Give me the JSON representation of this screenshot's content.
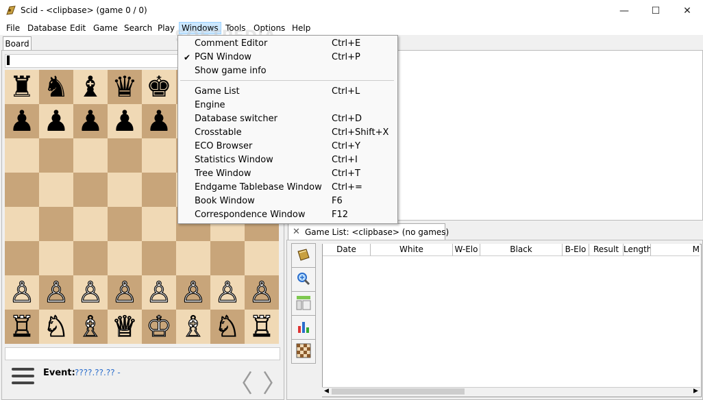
{
  "window": {
    "title": "Scid - <clipbase> (game 0 / 0)",
    "minimize_glyph": "—",
    "maximize_glyph": "☐",
    "close_glyph": "✕"
  },
  "menubar": {
    "items": [
      "File",
      "Database",
      "Edit",
      "Game",
      "Search",
      "Play",
      "Windows",
      "Tools",
      "Options",
      "Help"
    ],
    "active": "Windows"
  },
  "board_tab": {
    "label": "Board"
  },
  "board": {
    "rows": [
      [
        "♜",
        "♞",
        "♝",
        "♛",
        "♚",
        "",
        "",
        ""
      ],
      [
        "♟",
        "♟",
        "♟",
        "♟",
        "♟",
        "",
        "",
        ""
      ],
      [
        "",
        "",
        "",
        "",
        "",
        "",
        "",
        ""
      ],
      [
        "",
        "",
        "",
        "",
        "",
        "",
        "",
        ""
      ],
      [
        "",
        "",
        "",
        "",
        "",
        "",
        "",
        ""
      ],
      [
        "",
        "",
        "",
        "",
        "",
        "",
        "",
        ""
      ],
      [
        "♙",
        "♙",
        "♙",
        "♙",
        "♙",
        "♙",
        "♙",
        "♙"
      ],
      [
        "♖",
        "♘",
        "♗",
        "♕",
        "♔",
        "♗",
        "♘",
        "♖"
      ]
    ],
    "light_color": "#f0d9b5",
    "dark_color": "#c8a57a"
  },
  "event": {
    "label": "Event:",
    "value": "????.??.?? -"
  },
  "nav": {
    "prev": "〈",
    "next": "〉"
  },
  "game_list": {
    "tab_title": "Game List: <clipbase> (no games)",
    "close_glyph": "✕",
    "columns": [
      "Date",
      "White",
      "W-Elo",
      "Black",
      "B-Elo",
      "Result",
      "Length",
      "M"
    ]
  },
  "watermark": "SOFTPEDIA",
  "windows_menu": {
    "items": [
      {
        "label": "Comment Editor",
        "accel": "Ctrl+E",
        "checked": false
      },
      {
        "label": "PGN Window",
        "accel": "Ctrl+P",
        "checked": true
      },
      {
        "label": "Show game info",
        "accel": "",
        "checked": false
      },
      {
        "label": "Game List",
        "accel": "Ctrl+L",
        "checked": false
      },
      {
        "label": "Engine",
        "accel": "",
        "checked": false
      },
      {
        "label": "Database switcher",
        "accel": "Ctrl+D",
        "checked": false
      },
      {
        "label": "Crosstable",
        "accel": "Ctrl+Shift+X",
        "checked": false
      },
      {
        "label": "ECO Browser",
        "accel": "Ctrl+Y",
        "checked": false
      },
      {
        "label": "Statistics Window",
        "accel": "Ctrl+I",
        "checked": false
      },
      {
        "label": "Tree Window",
        "accel": "Ctrl+T",
        "checked": false
      },
      {
        "label": "Endgame Tablebase Window",
        "accel": "Ctrl+=",
        "checked": false
      },
      {
        "label": "Book Window",
        "accel": "F6",
        "checked": false
      },
      {
        "label": "Correspondence Window",
        "accel": "F12",
        "checked": false
      }
    ],
    "check_glyph": "✔"
  }
}
